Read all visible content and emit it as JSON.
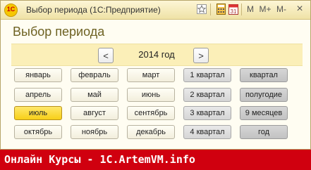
{
  "window": {
    "title": "Выбор периода  (1С:Предприятие)",
    "logo_text": "1С",
    "toolbar": {
      "m_label": "M",
      "mplus_label": "M+",
      "mminus_label": "M-",
      "close_label": "×",
      "calendar_day": "31"
    }
  },
  "form": {
    "heading": "Выбор периода",
    "year_label": "2014 год",
    "prev_label": "<",
    "next_label": ">"
  },
  "months": [
    [
      "январь",
      "февраль",
      "март"
    ],
    [
      "апрель",
      "май",
      "июнь"
    ],
    [
      "июль",
      "август",
      "сентябрь"
    ],
    [
      "октябрь",
      "ноябрь",
      "декабрь"
    ]
  ],
  "selected_month": "июль",
  "quarters": [
    "1 квартал",
    "2 квартал",
    "3 квартал",
    "4 квартал"
  ],
  "periods": [
    "квартал",
    "полугодие",
    "9 месяцев",
    "год"
  ],
  "footer_text": "Онлайн Курсы - 1С.ArtemVM.info",
  "colors": {
    "selected": "#f7cf18",
    "footer": "#d0000f",
    "yearbar": "#fbefb8"
  }
}
